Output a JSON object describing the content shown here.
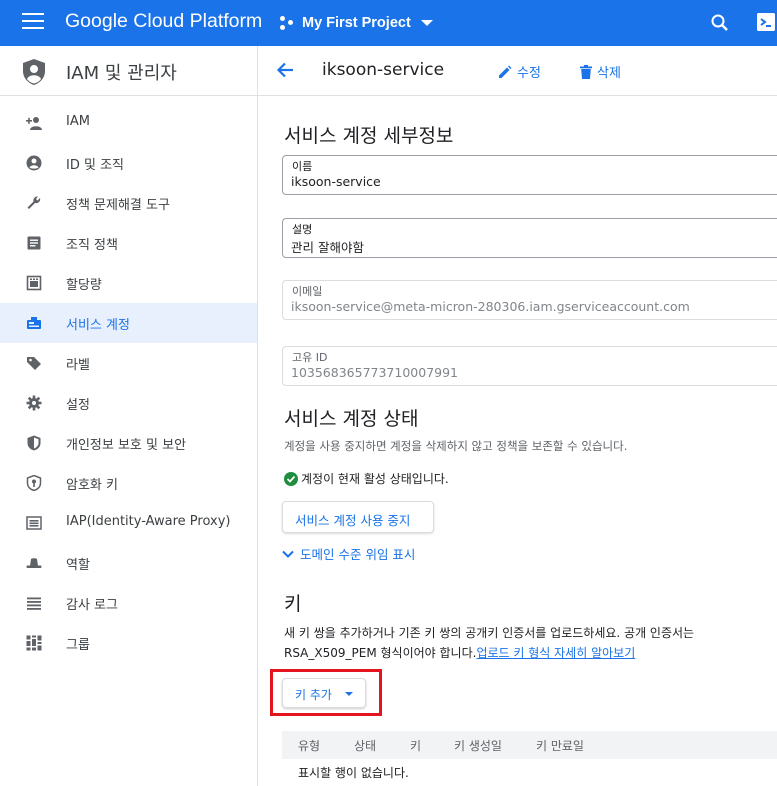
{
  "topbar": {
    "brand": "Google Cloud Platform",
    "project": "My First Project"
  },
  "leftnav": {
    "title": "IAM 및 관리자",
    "items": [
      {
        "label": "IAM",
        "icon": "person-add-icon"
      },
      {
        "label": "ID 및 조직",
        "icon": "account-circle-icon"
      },
      {
        "label": "정책 문제해결 도구",
        "icon": "wrench-icon"
      },
      {
        "label": "조직 정책",
        "icon": "article-icon"
      },
      {
        "label": "할당량",
        "icon": "quota-icon"
      },
      {
        "label": "서비스 계정",
        "icon": "service-account-icon"
      },
      {
        "label": "라벨",
        "icon": "label-tag-icon"
      },
      {
        "label": "설정",
        "icon": "gear-icon"
      },
      {
        "label": "개인정보 보호 및 보안",
        "icon": "privacy-shield-icon"
      },
      {
        "label": "암호화 키",
        "icon": "key-shield-icon"
      },
      {
        "label": "IAP(Identity-Aware Proxy)",
        "icon": "iap-icon"
      },
      {
        "label": "역할",
        "icon": "hat-icon"
      },
      {
        "label": "감사 로그",
        "icon": "list-icon"
      },
      {
        "label": "그룹",
        "icon": "groups-icon"
      }
    ],
    "active_index": 5
  },
  "header": {
    "title": "iksoon-service",
    "edit_label": "수정",
    "delete_label": "삭제"
  },
  "details": {
    "heading": "서비스 계정 세부정보",
    "name_label": "이름",
    "name_value": "iksoon-service",
    "desc_label": "설명",
    "desc_value": "관리 잘해야함",
    "email_label": "이메일",
    "email_value": "iksoon-service@meta-micron-280306.iam.gserviceaccount.com",
    "uid_label": "고유 ID",
    "uid_value": "103568365773710007991"
  },
  "status": {
    "heading": "서비스 계정 상태",
    "description": "계정을 사용 중지하면 계정을 삭제하지 않고 정책을 보존할 수 있습니다.",
    "active_text": "계정이 현재 활성 상태입니다.",
    "disable_button": "서비스 계정 사용 중지",
    "domain_delegation_link": "도메인 수준 위임 표시"
  },
  "keys": {
    "heading": "키",
    "description_line1": "새 키 쌍을 추가하거나 기존 키 쌍의 공개키 인증서를 업로드하세요. 공개 인증서는",
    "description_line2": "RSA_X509_PEM 형식이어야 합니다.",
    "learn_more_link": "업로드 키 형식 자세히 알아보기",
    "add_key_button": "키 추가",
    "columns": [
      "유형",
      "상태",
      "키",
      "키 생성일",
      "키 만료일"
    ],
    "empty_message": "표시할 행이 없습니다."
  },
  "colors": {
    "brand_blue": "#1a73e8",
    "highlight_red": "#e3141e",
    "active_nav_bg": "#e8f0fe",
    "success_green": "#1e8e3e"
  }
}
